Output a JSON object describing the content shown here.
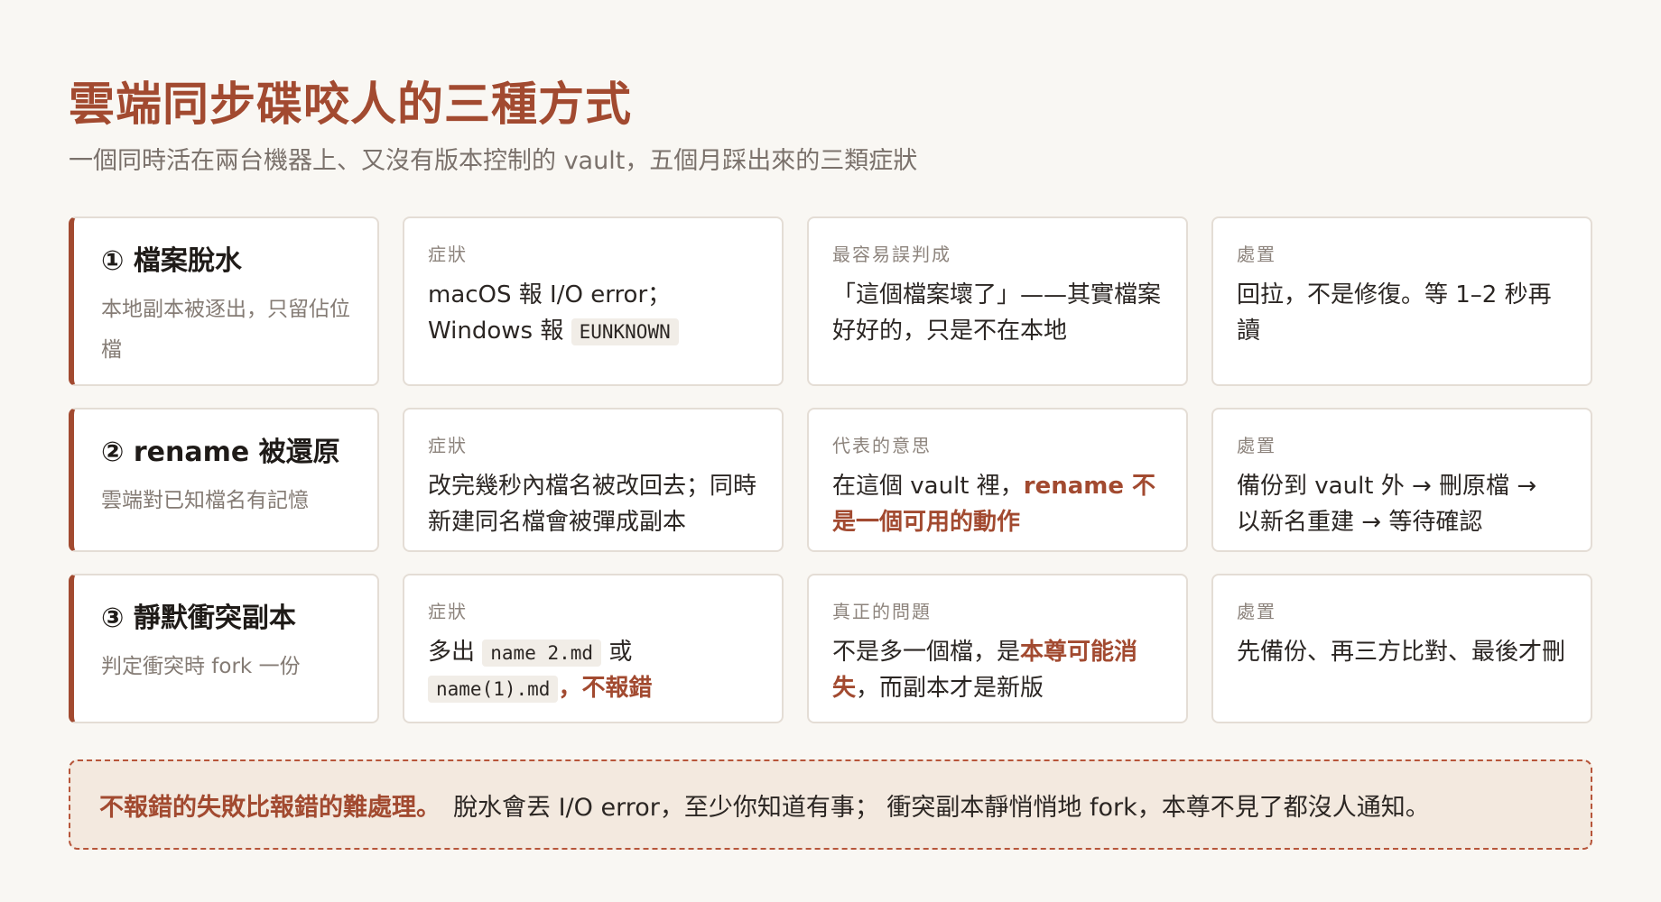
{
  "title": "雲端同步碟咬人的三種方式",
  "subtitle": "一個同時活在兩台機器上、又沒有版本控制的 vault，五個月踩出來的三類症狀",
  "rows": [
    {
      "head": {
        "title": "① 檔案脫水",
        "desc": "本地副本被逐出，只留佔位檔"
      },
      "c1": {
        "label": "症狀",
        "t1": "macOS 報 I/O error；Windows 報 ",
        "code1": "EUNKNOWN"
      },
      "c2": {
        "label": "最容易誤判成",
        "t1": "「這個檔案壞了」——其實檔案好好的，只是不在本地"
      },
      "c3": {
        "label": "處置",
        "t1": "回拉，不是修復。等 1–2 秒再讀"
      }
    },
    {
      "head": {
        "title": "② rename 被還原",
        "desc": "雲端對已知檔名有記憶"
      },
      "c1": {
        "label": "症狀",
        "t1": "改完幾秒內檔名被改回去；同時新建同名檔會被彈成副本"
      },
      "c2": {
        "label": "代表的意思",
        "t1": "在這個 vault 裡，",
        "em": "rename 不是一個可用的動作"
      },
      "c3": {
        "label": "處置",
        "t1": "備份到 vault 外 → 刪原檔 → 以新名重建 → 等待確認"
      }
    },
    {
      "head": {
        "title": "③ 靜默衝突副本",
        "desc": "判定衝突時 fork 一份"
      },
      "c1": {
        "label": "症狀",
        "t1": "多出 ",
        "code1": "name 2.md",
        "t2": " 或 ",
        "code2": "name(1).md",
        "em": "，不報錯"
      },
      "c2": {
        "label": "真正的問題",
        "t1": "不是多一個檔，是",
        "em": "本尊可能消失",
        "t2": "，而副本才是新版"
      },
      "c3": {
        "label": "處置",
        "t1": "先備份、再三方比對、最後才刪"
      }
    }
  ],
  "callout": {
    "em": "不報錯的失敗比報錯的難處理。",
    "text": "脫水會丟 I/O error，至少你知道有事； 衝突副本靜悄悄地 fork，本尊不見了都沒人通知。"
  }
}
